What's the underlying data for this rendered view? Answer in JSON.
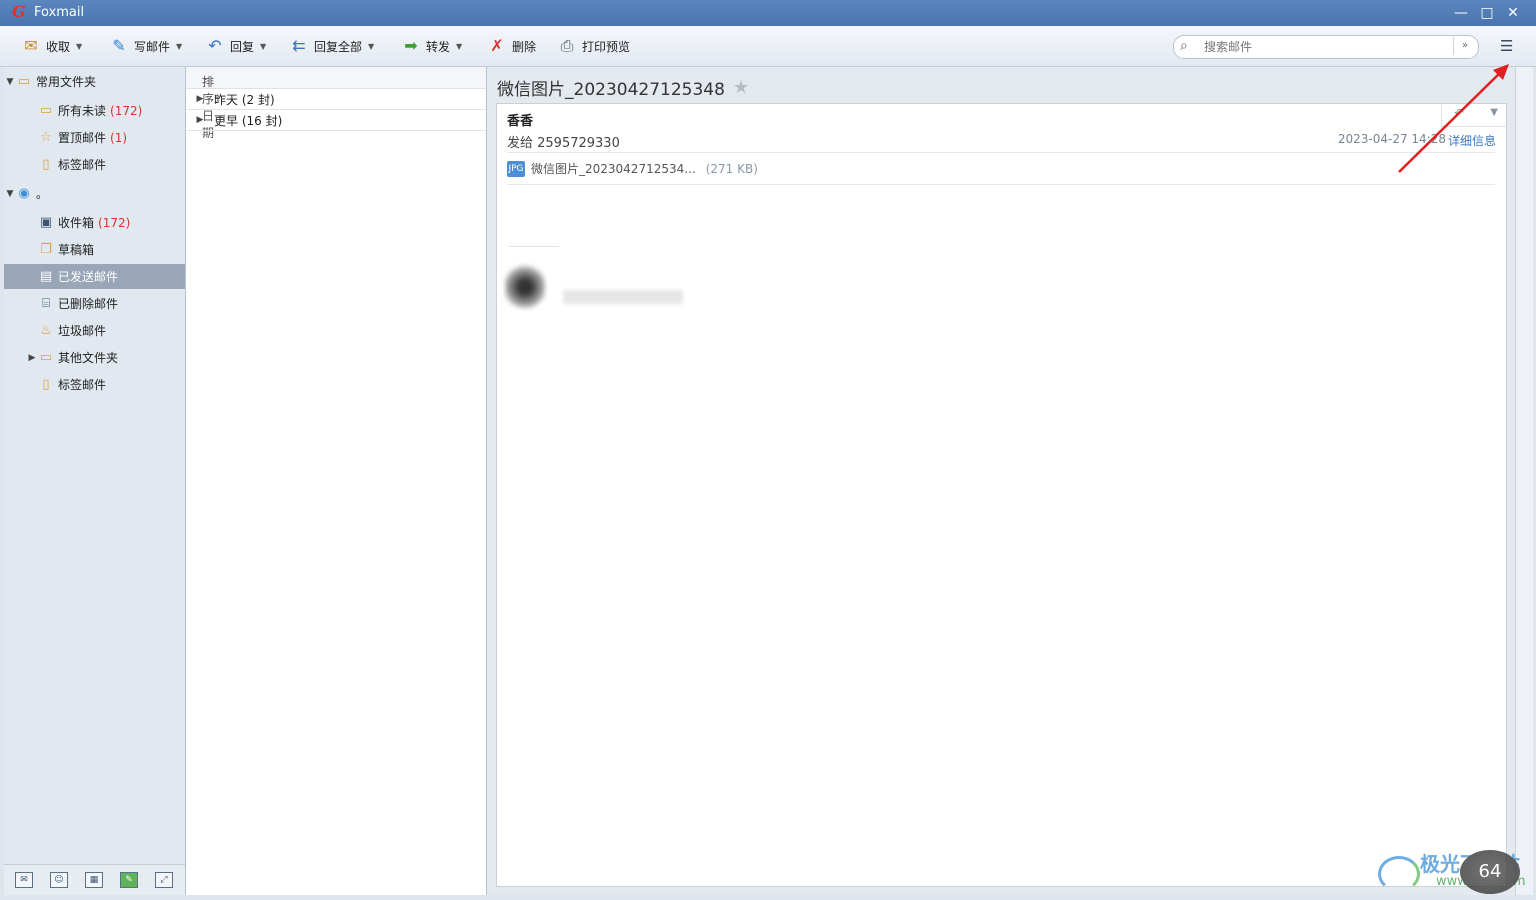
{
  "app": {
    "title": "Foxmail"
  },
  "window_controls": {
    "minimize": "—",
    "maximize": "□",
    "close": "✕"
  },
  "toolbar": {
    "receive": "收取",
    "compose": "写邮件",
    "reply": "回复",
    "reply_all": "回复全部",
    "forward": "转发",
    "delete": "删除",
    "print_preview": "打印预览",
    "search_placeholder": "搜索邮件"
  },
  "sidebar": {
    "common_folders": "常用文件夹",
    "items_common": [
      {
        "label": "所有未读",
        "count": "(172)"
      },
      {
        "label": "置顶邮件",
        "count": "(1)"
      },
      {
        "label": "标签邮件",
        "count": ""
      }
    ],
    "account_label": "。",
    "items_account": [
      {
        "label": "收件箱",
        "count": "(172)"
      },
      {
        "label": "草稿箱",
        "count": ""
      },
      {
        "label": "已发送邮件",
        "count": ""
      },
      {
        "label": "已删除邮件",
        "count": ""
      },
      {
        "label": "垃圾邮件",
        "count": ""
      },
      {
        "label": "其他文件夹",
        "count": ""
      },
      {
        "label": "标签邮件",
        "count": ""
      }
    ]
  },
  "list": {
    "sort_label": "排序:日期",
    "groups": [
      {
        "label": "昨天 (2 封)"
      },
      {
        "label": "更早 (16 封)"
      }
    ]
  },
  "reader": {
    "subject": "微信图片_20230427125348",
    "sender": "香香",
    "to_line": "发给 2595729330",
    "date": "2023-04-27 14:28",
    "details_link": "详细信息",
    "attachment_name": "微信图片_2023042712534...",
    "attachment_size": "(271 KB)"
  },
  "watermark": {
    "brand": "极光下载站",
    "url": "www.xz7.com",
    "badge": "64"
  }
}
